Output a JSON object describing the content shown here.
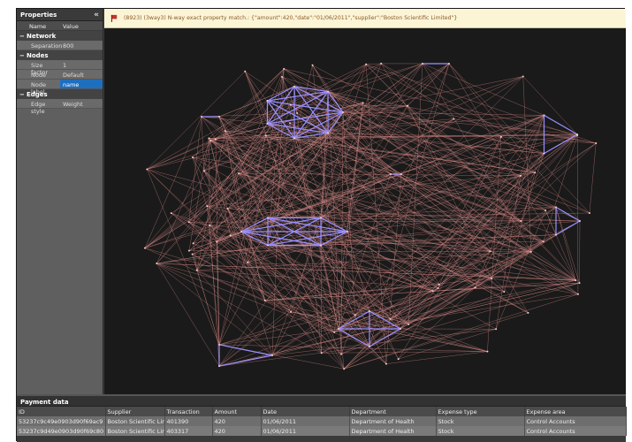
{
  "properties": {
    "title": "Properties",
    "collapse_glyph": "«",
    "col_name": "Name",
    "col_value": "Value",
    "sections": [
      {
        "label": "Network",
        "rows": [
          {
            "key": "Separation",
            "value": "800"
          }
        ]
      },
      {
        "label": "Nodes",
        "rows": [
          {
            "key": "Size factor",
            "value": "1"
          },
          {
            "key": "Node style",
            "value": "Default"
          },
          {
            "key": "Node label",
            "value": "name",
            "selected": true
          }
        ]
      },
      {
        "label": "Edges",
        "rows": [
          {
            "key": "Edge style",
            "value": "Weight"
          }
        ]
      }
    ]
  },
  "banner": {
    "icon": "warning-flag-icon",
    "text": "(8923) (3way3) N-way exact property match.: {\"amount\":420,\"date\":\"01/06/2011\",\"supplier\":\"Boston Scientific Limited\"}"
  },
  "graph": {
    "background": "#1a1a1a",
    "edge_color": "#d98a86",
    "highlight_color": "#9b90ff"
  },
  "payment": {
    "title": "Payment data",
    "columns": [
      "ID",
      "Supplier",
      "Transaction",
      "Amount",
      "Date",
      "Department",
      "Expense type",
      "Expense area"
    ],
    "rows": [
      [
        "53237c9c49e0903d90f69ac9",
        "Boston Scientific Lin",
        "401390",
        "420",
        "01/06/2011",
        "Department of Health",
        "Stock",
        "Control Accounts"
      ],
      [
        "53237c9d49e0903d90f69c80",
        "Boston Scientific Lin",
        "403317",
        "420",
        "01/06/2011",
        "Department of Health",
        "Stock",
        "Control Accounts"
      ]
    ]
  }
}
